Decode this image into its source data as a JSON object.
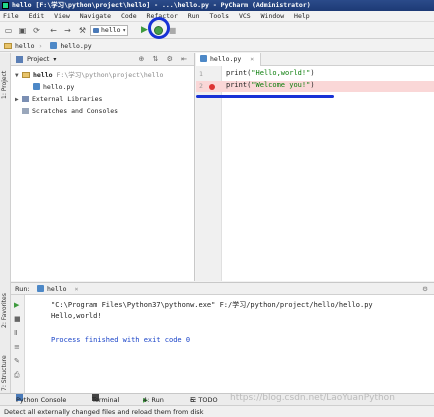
{
  "window": {
    "title": "hello [F:\\学习\\python\\project\\hello] - ...\\hello.py - PyCharm (Administrator)"
  },
  "menu": [
    "File",
    "Edit",
    "View",
    "Navigate",
    "Code",
    "Refactor",
    "Run",
    "Tools",
    "VCS",
    "Window",
    "Help"
  ],
  "toolbar": {
    "run_config": "hello"
  },
  "breadcrumb": {
    "project": "hello",
    "file": "hello.py"
  },
  "left_tabs": {
    "project": "1: Project",
    "favorites": "2: Favorites",
    "structure": "7: Structure"
  },
  "project_panel": {
    "title": "Project",
    "root_name": "hello",
    "root_path": "F:\\学习\\python\\project\\hello",
    "file": "hello.py",
    "external": "External Libraries",
    "scratches": "Scratches and Consoles"
  },
  "editor": {
    "tab": "hello.py",
    "lines": [
      {
        "num": "1",
        "prefix": "print(",
        "str": "\"Hello,world!\"",
        "suffix": ")"
      },
      {
        "num": "2",
        "prefix": "print(",
        "str": "\"Welcome you!\"",
        "suffix": ")"
      }
    ]
  },
  "run_panel": {
    "label": "Run:",
    "tab": "hello",
    "output": [
      "\"C:\\Program Files\\Python37\\pythonw.exe\" F:/学习/python/project/hello/hello.py",
      "Hello,world!",
      "",
      "Process finished with exit code 0"
    ]
  },
  "bottom_tabs": {
    "python_console": "Python Console",
    "terminal": "Terminal",
    "run": "4: Run",
    "todo": "6: TODO"
  },
  "watermark": "https://blog.csdn.net/LaoYuanPython",
  "status": "Detect all externally changed files and reload them from disk",
  "colors": {
    "annotation": "#1832d6",
    "error_line": "#fad7d7",
    "string": "#0a7d0a"
  }
}
